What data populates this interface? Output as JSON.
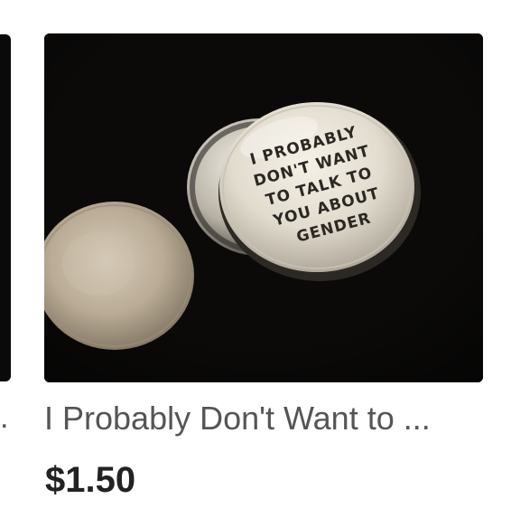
{
  "previous_card": {
    "title": "."
  },
  "product_card": {
    "title": "I Probably Don't Want to ...",
    "price": "$1.50",
    "image": {
      "subject": "pin-button-photo",
      "button_text": {
        "line1": "I PROBABLY",
        "line2": "DON'T WANT",
        "line3": "TO TALK TO",
        "line4": "YOU ABOUT",
        "line5": "GENDER"
      }
    }
  },
  "colors": {
    "title_text": "#555555",
    "price_text": "#222222",
    "photo_background": "#0d0c0a"
  }
}
